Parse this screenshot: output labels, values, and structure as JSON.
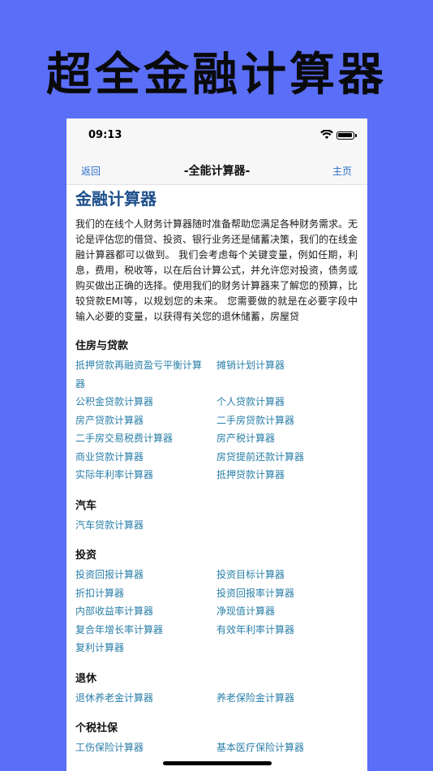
{
  "promo": {
    "title": "超全金融计算器"
  },
  "status_bar": {
    "time": "09:13"
  },
  "nav": {
    "back_label": "返回",
    "title": "-全能计算器-",
    "home_label": "主页"
  },
  "main": {
    "title": "金融计算器",
    "intro": "我们的在线个人财务计算器随时准备帮助您满足各种财务需求。无论是评估您的借贷、投资、银行业务还是储蓄决策，我们的在线金融计算器都可以做到。 我们会考虑每个关键变量，例如任期，利息，费用，税收等，以在后台计算公式，并允许您对投资，债务或购买做出正确的选择。使用我们的财务计算器来了解您的预算，比较贷款EMI等，以规划您的未来。 您需要做的就是在必要字段中输入必要的变量，以获得有关您的退休储蓄，房屋贷"
  },
  "sections": [
    {
      "title": "住房与贷款",
      "links": [
        "抵押贷款再融资盈亏平衡计算器",
        "摊销计划计算器",
        "公积金贷款计算器",
        "个人贷款计算器",
        "房产贷款计算器",
        "二手房贷款计算器",
        "二手房交易税费计算器",
        "房产税计算器",
        "商业贷款计算器",
        "房贷提前还款计算器",
        "实际年利率计算器",
        "抵押贷款计算器"
      ]
    },
    {
      "title": "汽车",
      "links": [
        "汽车贷款计算器"
      ]
    },
    {
      "title": "投资",
      "links": [
        "投资回报计算器",
        "投资目标计算器",
        "折扣计算器",
        "投资回报率计算器",
        "内部收益率计算器",
        "净现值计算器",
        "复合年增长率计算器",
        "有效年利率计算器",
        "复利计算器"
      ]
    },
    {
      "title": "退休",
      "links": [
        "退休养老金计算器",
        "养老保险金计算器"
      ]
    },
    {
      "title": "个税社保",
      "links": [
        "工伤保险计算器",
        "基本医疗保险计算器"
      ]
    }
  ]
}
